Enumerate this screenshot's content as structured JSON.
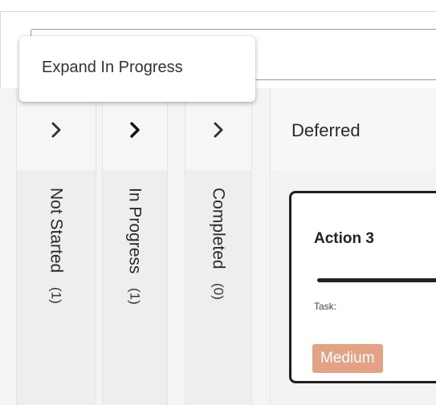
{
  "tooltip": {
    "text": "Expand In Progress"
  },
  "columns": [
    {
      "name": "Not Started",
      "count": "(1)",
      "chevron": "chevron-right-icon"
    },
    {
      "name": "In Progress",
      "count": "(1)",
      "chevron": "chevron-right-icon"
    },
    {
      "name": "Completed",
      "count": "(0)",
      "chevron": "chevron-right-icon"
    }
  ],
  "deferred": {
    "title": "Deferred",
    "card": {
      "title": "Action 3",
      "task_label": "Task:",
      "priority": "Medium",
      "priority_color": "#e4a285"
    }
  }
}
